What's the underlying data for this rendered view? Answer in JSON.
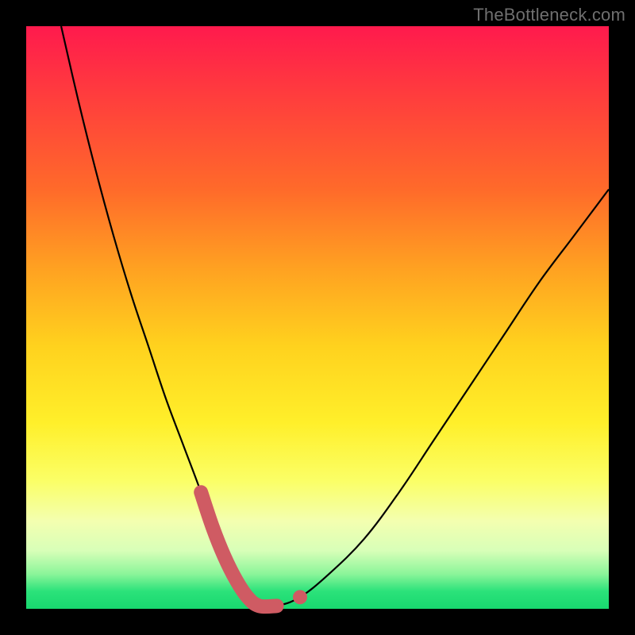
{
  "watermark": "TheBottleneck.com",
  "chart_data": {
    "type": "line",
    "title": "",
    "xlabel": "",
    "ylabel": "",
    "xlim": [
      0,
      100
    ],
    "ylim": [
      0,
      100
    ],
    "background_gradient": {
      "orientation": "vertical",
      "stops": [
        {
          "pos": 0,
          "color": "#ff1a4d"
        },
        {
          "pos": 28,
          "color": "#ff6a2a"
        },
        {
          "pos": 55,
          "color": "#ffd21e"
        },
        {
          "pos": 78,
          "color": "#fbff66"
        },
        {
          "pos": 90,
          "color": "#d8ffb8"
        },
        {
          "pos": 100,
          "color": "#18d86f"
        }
      ]
    },
    "series": [
      {
        "name": "bottleneck-curve",
        "color": "#000000",
        "x": [
          6,
          9,
          12,
          15,
          18,
          21,
          24,
          27,
          30,
          32,
          34,
          36,
          38,
          40,
          43,
          47,
          52,
          58,
          64,
          70,
          76,
          82,
          88,
          94,
          100
        ],
        "y": [
          100,
          87,
          75,
          64,
          54,
          45,
          36,
          28,
          20,
          14,
          9,
          5,
          2,
          0.5,
          0.5,
          2,
          6,
          12,
          20,
          29,
          38,
          47,
          56,
          64,
          72
        ]
      }
    ],
    "highlight": {
      "name": "optimal-range-marker",
      "color": "#cf5b63",
      "segment": {
        "x": [
          30,
          32,
          34,
          36,
          38,
          40,
          43
        ],
        "y": [
          20,
          14,
          9,
          5,
          2,
          0.5,
          0.5
        ]
      },
      "detached_point": {
        "x": 47,
        "y": 2
      }
    }
  }
}
